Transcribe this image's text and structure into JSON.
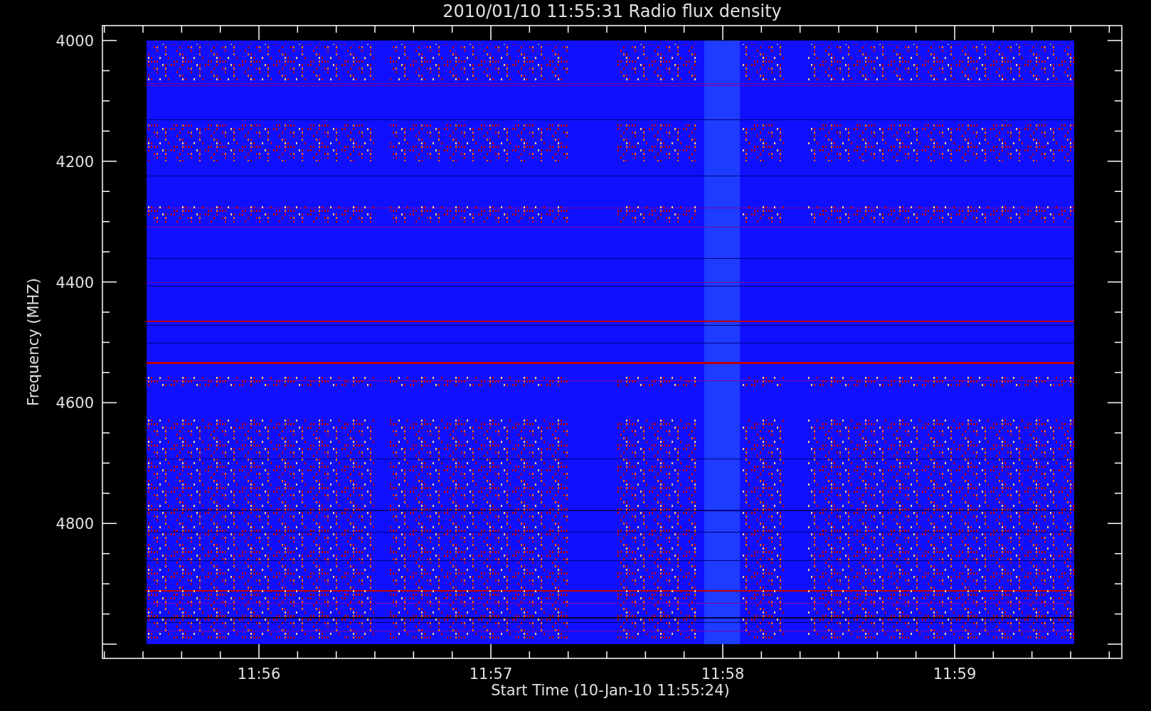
{
  "title": "2010/01/10 11:55:31 Radio flux density",
  "y_axis": {
    "label": "Frequency (MHZ)",
    "ticks": [
      "4000",
      "4200",
      "4400",
      "4600",
      "4800"
    ]
  },
  "x_axis": {
    "label": "Start Time (10-Jan-10 11:55:24)",
    "ticks": [
      "11:56",
      "11:57",
      "11:58",
      "11:59"
    ]
  }
}
